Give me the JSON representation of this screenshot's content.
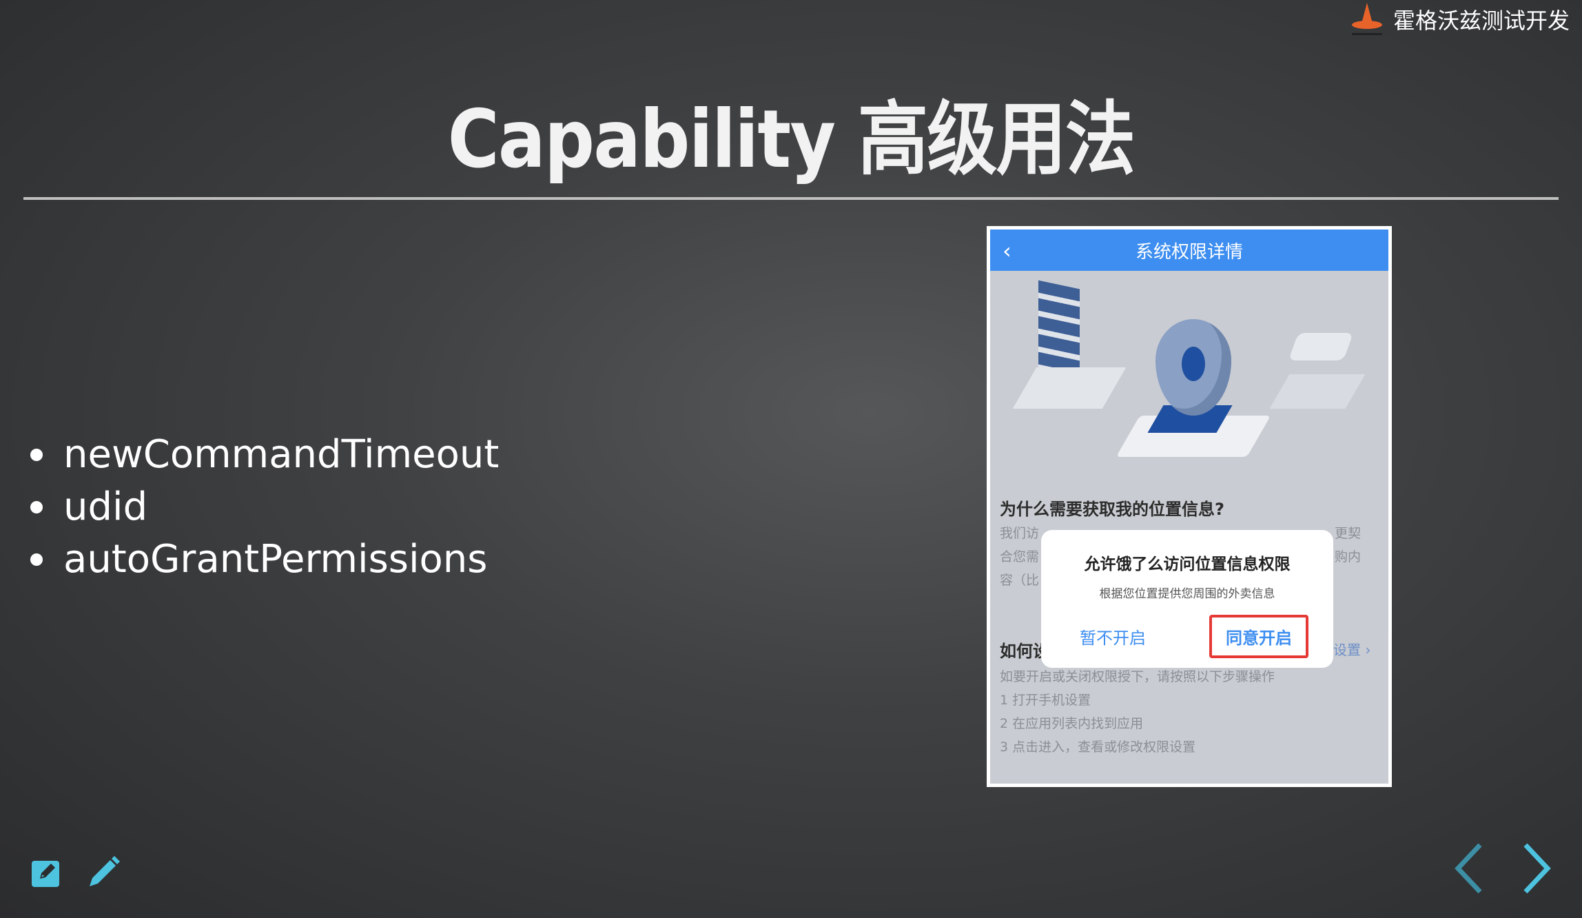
{
  "brand": {
    "name": "霍格沃兹测试开发"
  },
  "slide": {
    "title": "Capability 高级用法",
    "bullets": [
      "newCommandTimeout",
      "udid",
      "autoGrantPermissions"
    ]
  },
  "screenshot": {
    "header_title": "系统权限详情",
    "section_title": "为什么需要获取我的位置信息?",
    "para_lines": [
      "我们访",
      "合您需",
      "容（比"
    ],
    "para_right": [
      "更契",
      "购内"
    ],
    "how_title": "如何设",
    "how_link": "设置 ›",
    "steps": [
      "如要开启或关闭权限授下，请按照以下步骤操作",
      "1 打开手机设置",
      "2 在应用列表内找到应用",
      "3 点击进入，查看或修改权限设置"
    ],
    "dialog": {
      "title": "允许饿了么访问位置信息权限",
      "subtitle": "根据您位置提供您周围的外卖信息",
      "cancel": "暂不开启",
      "confirm": "同意开启"
    }
  },
  "colors": {
    "accent": "#3d8ef0",
    "tool_icon": "#4dc3e0",
    "highlight_border": "#e53935"
  },
  "icons": {
    "edit": "edit-square-icon",
    "pen": "pencil-icon",
    "prev": "chevron-left-icon",
    "next": "chevron-right-icon",
    "logo": "brand-logo-icon"
  }
}
